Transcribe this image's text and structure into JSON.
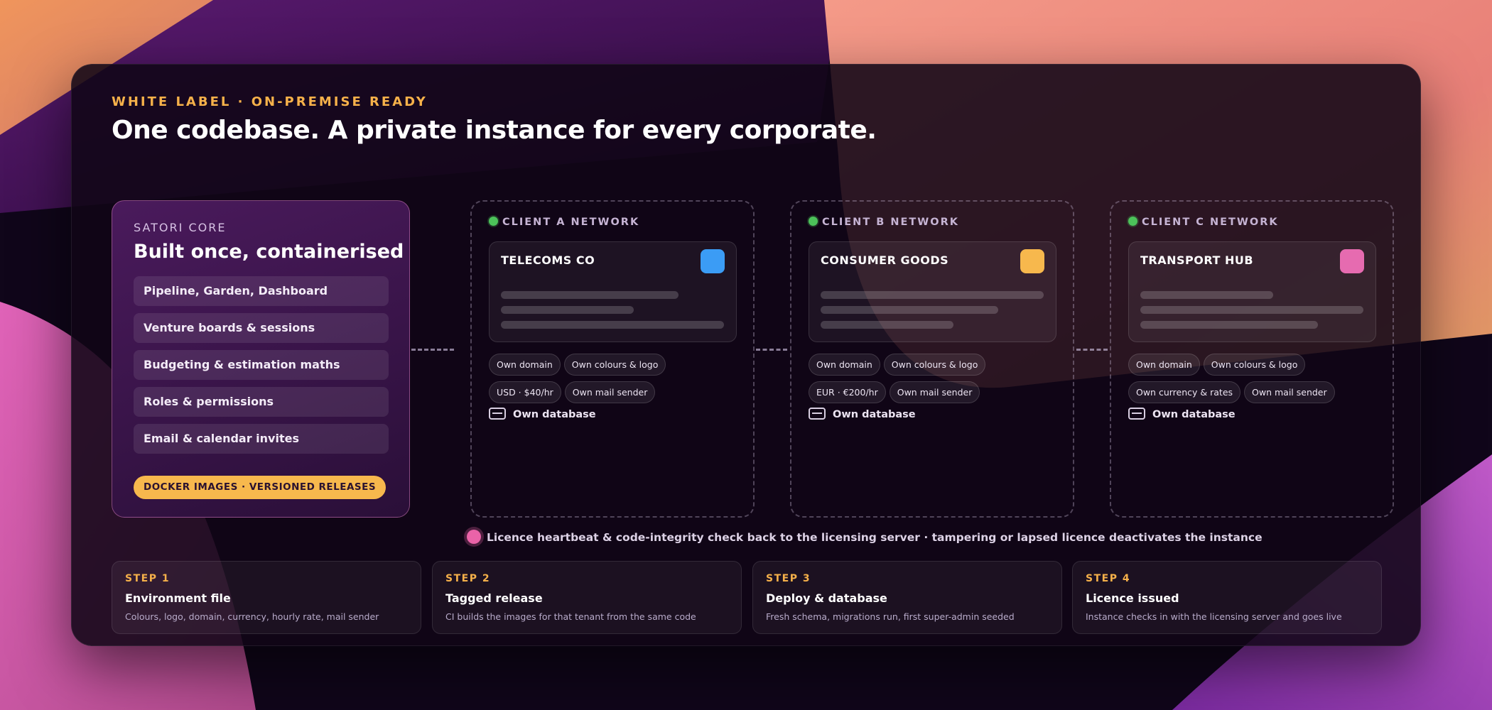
{
  "header": {
    "eyebrow": "WHITE LABEL · ON-PREMISE READY",
    "title": "One codebase. A private instance for every corporate."
  },
  "core": {
    "label": "SATORI CORE",
    "title": "Built once, containerised",
    "features": [
      "Pipeline, Garden, Dashboard",
      "Venture boards & sessions",
      "Budgeting & estimation maths",
      "Roles & permissions",
      "Email & calendar invites"
    ],
    "badge": "DOCKER IMAGES · VERSIONED RELEASES",
    "colors": {
      "accent": "#f7b84d",
      "panel": "#4a1a5c"
    }
  },
  "clients": [
    {
      "network_label": "CLIENT A NETWORK",
      "tenant": "TELECOMS CO",
      "swatch_color": "#3b9cf5",
      "pills": [
        "Own domain",
        "Own colours & logo",
        "USD · $40/hr",
        "Own mail sender"
      ],
      "database": "Own database",
      "status_icon": "status-dot-icon"
    },
    {
      "network_label": "CLIENT B NETWORK",
      "tenant": "CONSUMER GOODS",
      "swatch_color": "#f7b84d",
      "pills": [
        "Own domain",
        "Own colours & logo",
        "EUR · €200/hr",
        "Own mail sender"
      ],
      "database": "Own database",
      "status_icon": "status-dot-icon"
    },
    {
      "network_label": "CLIENT C NETWORK",
      "tenant": "TRANSPORT HUB",
      "swatch_color": "#e66bb0",
      "pills": [
        "Own domain",
        "Own colours & logo",
        "Own currency & rates",
        "Own mail sender"
      ],
      "database": "Own database",
      "status_icon": "status-dot-icon"
    }
  ],
  "heartbeat": {
    "text": "Licence heartbeat & code-integrity check back to the licensing server · tampering or lapsed licence deactivates the instance",
    "dot_color": "#ea63a8"
  },
  "steps": [
    {
      "num": "STEP 1",
      "title": "Environment file",
      "desc": "Colours, logo, domain, currency, hourly rate, mail sender"
    },
    {
      "num": "STEP 2",
      "title": "Tagged release",
      "desc": "CI builds the images for that tenant from the same code"
    },
    {
      "num": "STEP 3",
      "title": "Deploy & database",
      "desc": "Fresh schema, migrations run, first super-admin seeded"
    },
    {
      "num": "STEP 4",
      "title": "Licence issued",
      "desc": "Instance checks in with the licensing server and goes live"
    }
  ]
}
